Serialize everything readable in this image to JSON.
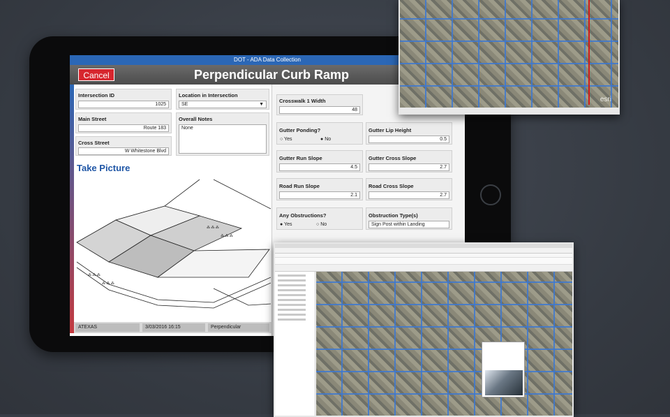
{
  "window_title": "DOT - ADA Data Collection",
  "header": {
    "cancel_label": "Cancel",
    "form_title": "Perpendicular Curb Ramp"
  },
  "left": {
    "intersection_id": {
      "label": "Intersection ID",
      "value": "1025"
    },
    "location": {
      "label": "Location in Intersection",
      "value": "SE"
    },
    "main_street": {
      "label": "Main Street",
      "value": "Route 183"
    },
    "overall_notes": {
      "label": "Overall Notes",
      "value": "None"
    },
    "cross_street": {
      "label": "Cross Street",
      "value": "W Whitestone Blvd"
    },
    "take_picture": "Take Picture"
  },
  "right": {
    "crosswalk_width": {
      "label": "Crosswalk 1 Width",
      "value": "48"
    },
    "gutter_ponding": {
      "label": "Gutter Ponding?",
      "yes": "Yes",
      "no": "No"
    },
    "gutter_lip_height": {
      "label": "Gutter Lip Height",
      "value": "0.5"
    },
    "gutter_run_slope": {
      "label": "Gutter Run Slope",
      "value": "4.5"
    },
    "gutter_cross_slope": {
      "label": "Gutter Cross Slope",
      "value": "2.7"
    },
    "road_run_slope": {
      "label": "Road Run Slope",
      "value": "2.1"
    },
    "road_cross_slope": {
      "label": "Road Cross Slope",
      "value": "2.7"
    },
    "any_obstructions": {
      "label": "Any Obstructions?",
      "yes": "Yes",
      "no": "No"
    },
    "obstruction_types": {
      "label": "Obstruction Type(s)",
      "value": "Sign Post within Landing"
    }
  },
  "status": {
    "user": "ATEXAS",
    "datetime": "3/03/2016 16:15",
    "type": "Perpendicular"
  },
  "map_windows": {
    "esri_label": "esri"
  },
  "colors": {
    "accent_blue": "#2b67b6",
    "cancel_red": "#d7262e",
    "route_red": "#d11b1b"
  }
}
